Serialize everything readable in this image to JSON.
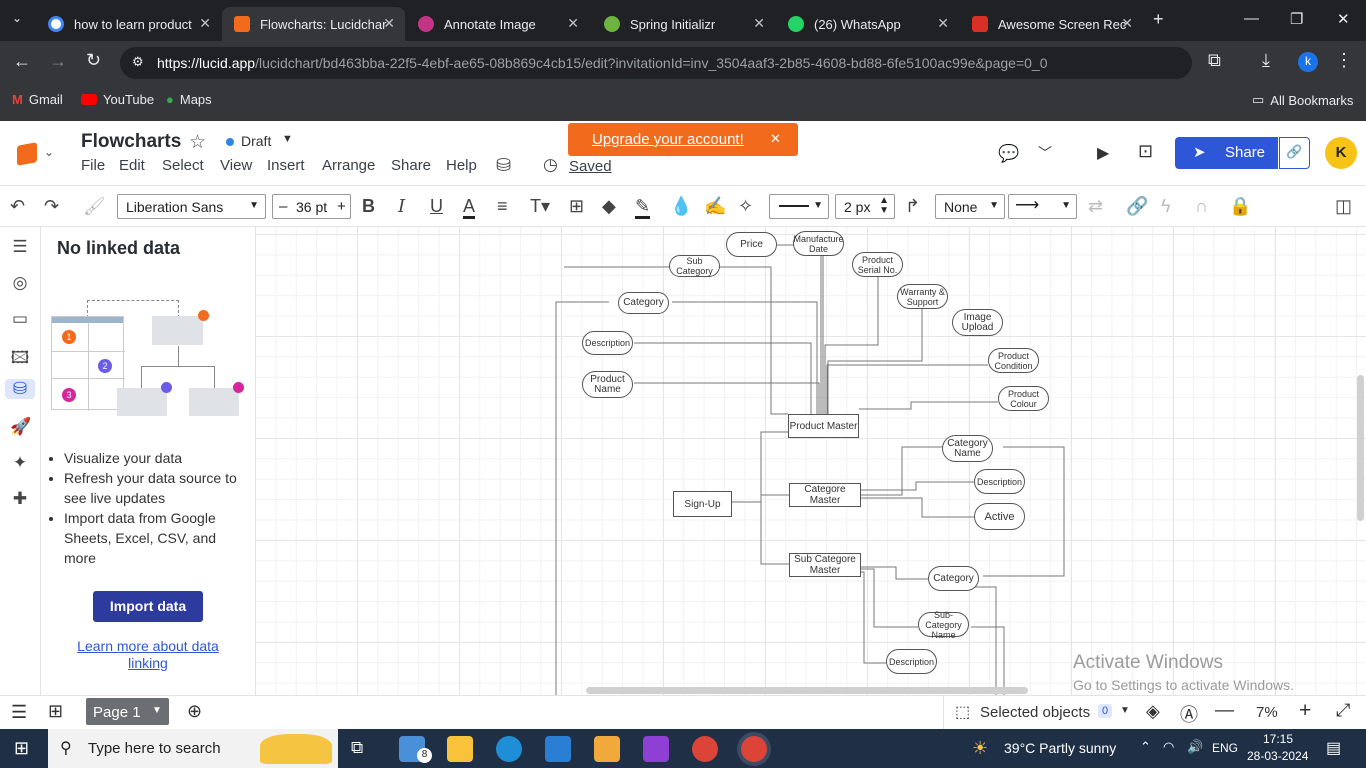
{
  "browser": {
    "tabs": [
      {
        "title": "how to learn product",
        "color": "#4285f4",
        "active": false
      },
      {
        "title": "Flowcharts: Lucidchar",
        "color": "#f26b1d",
        "active": true
      },
      {
        "title": "Annotate Image",
        "color": "#c13584",
        "active": false
      },
      {
        "title": "Spring Initializr",
        "color": "#6db33f",
        "active": false
      },
      {
        "title": "(26) WhatsApp",
        "color": "#25d366",
        "active": false
      },
      {
        "title": "Awesome Screen Rec",
        "color": "#d93025",
        "active": false
      }
    ],
    "url_host": "https://lucid.app",
    "url_path": "/lucidchart/bd463bba-22f5-4ebf-ae65-08b869c4cb15/edit?invitationId=inv_3504aaf3-2b85-4608-bd88-6fe5100ac99e&page=0_0",
    "bookmarks": [
      "Gmail",
      "YouTube",
      "Maps"
    ],
    "all_bookmarks": "All Bookmarks",
    "profile_initial": "k"
  },
  "app": {
    "doc_title": "Flowcharts",
    "status": "Draft",
    "menu": [
      "File",
      "Edit",
      "Select",
      "View",
      "Insert",
      "Arrange",
      "Share",
      "Help"
    ],
    "saved": "Saved",
    "upgrade_banner": "Upgrade your account!",
    "share_label": "Share",
    "avatar_initial": "K"
  },
  "toolbar": {
    "font": "Liberation Sans",
    "font_size": "36 pt",
    "line_width": "2 px",
    "line_end": "None"
  },
  "panel": {
    "title": "No linked data",
    "bullets": [
      "Visualize your data",
      "Refresh your data source to see live updates",
      "Import data from Google Sheets, Excel, CSV, and more"
    ],
    "import_button": "Import data",
    "learn_link": "Learn more about data linking",
    "illustration_numbers": [
      "1",
      "2",
      "3"
    ]
  },
  "diagram": {
    "price": "Price",
    "manufacture_date": "Manufacture Date",
    "sub_category": "Sub Category",
    "product_serial": "Product Serial No.",
    "category": "Category",
    "warranty": "Warranty & Support",
    "description": "Description",
    "image_upload": "Image Upload",
    "product_name": "Product Name",
    "product_condition": "Product Condition",
    "product_colour": "Product Colour",
    "product_master": "Product Master",
    "category_name": "Category Name",
    "sign_up": "Sign-Up",
    "categore_master": "Categore Master",
    "description2": "Description",
    "active": "Active",
    "sub_categore_master": "Sub Categore Master",
    "category2": "Category",
    "sub_category_name": "Sub-Category Name",
    "description3": "Description"
  },
  "watermark": {
    "line1": "Activate Windows",
    "line2": "Go to Settings to activate Windows."
  },
  "bottom": {
    "page": "Page 1",
    "selected_label": "Selected objects",
    "selected_count": "0",
    "zoom": "7%"
  },
  "taskbar": {
    "search_placeholder": "Type here to search",
    "weather": "39°C  Partly sunny",
    "lang": "ENG",
    "time": "17:15",
    "date": "28-03-2024",
    "mail_badge": "8"
  }
}
